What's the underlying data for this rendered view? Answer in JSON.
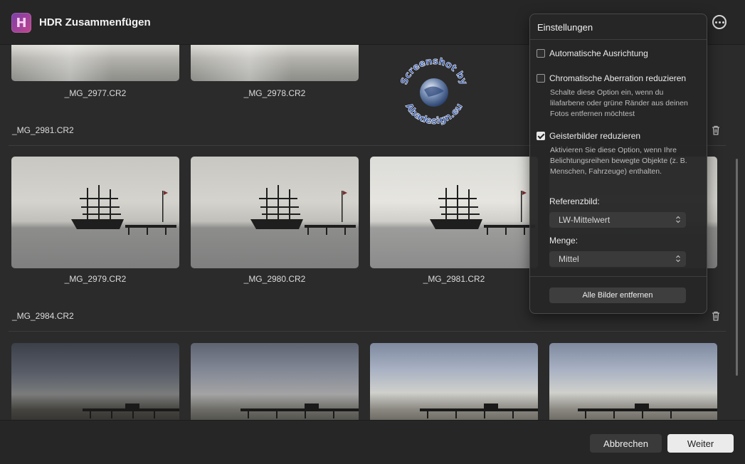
{
  "app": {
    "title": "HDR Zusammenfügen",
    "logo_letter": "H"
  },
  "groups": [
    {
      "label": "",
      "files": [
        "_MG_2977.CR2",
        "_MG_2978.CR2"
      ]
    },
    {
      "label": "_MG_2981.CR2",
      "files": [
        "_MG_2979.CR2",
        "_MG_2980.CR2",
        "_MG_2981.CR2"
      ]
    },
    {
      "label": "_MG_2984.CR2",
      "files": []
    }
  ],
  "settings": {
    "title": "Einstellungen",
    "auto_align": {
      "label": "Automatische Ausrichtung",
      "checked": false
    },
    "chromatic": {
      "label": "Chromatische Aberration reduzieren",
      "checked": false,
      "hint": "Schalte diese Option ein, wenn du lilafarbene oder grüne Ränder aus deinen Fotos entfernen möchtest"
    },
    "ghost": {
      "label": "Geisterbilder reduzieren",
      "checked": true,
      "hint": "Aktivieren Sie diese Option, wenn Ihre Belichtungsreihen bewegte Objekte (z. B. Menschen, Fahrzeuge) enthalten."
    },
    "reference_label": "Referenzbild:",
    "reference_value": "LW-Mittelwert",
    "amount_label": "Menge:",
    "amount_value": "Mittel",
    "remove_all": "Alle Bilder entfernen"
  },
  "footer": {
    "cancel": "Abbrechen",
    "next": "Weiter"
  },
  "watermark": {
    "top": "Screenshot by",
    "bottom": "Abadesign.eu"
  },
  "icons": {
    "more": "more-horizontal-icon",
    "trash": "trash-icon",
    "chevron": "chevron-updown-icon"
  }
}
